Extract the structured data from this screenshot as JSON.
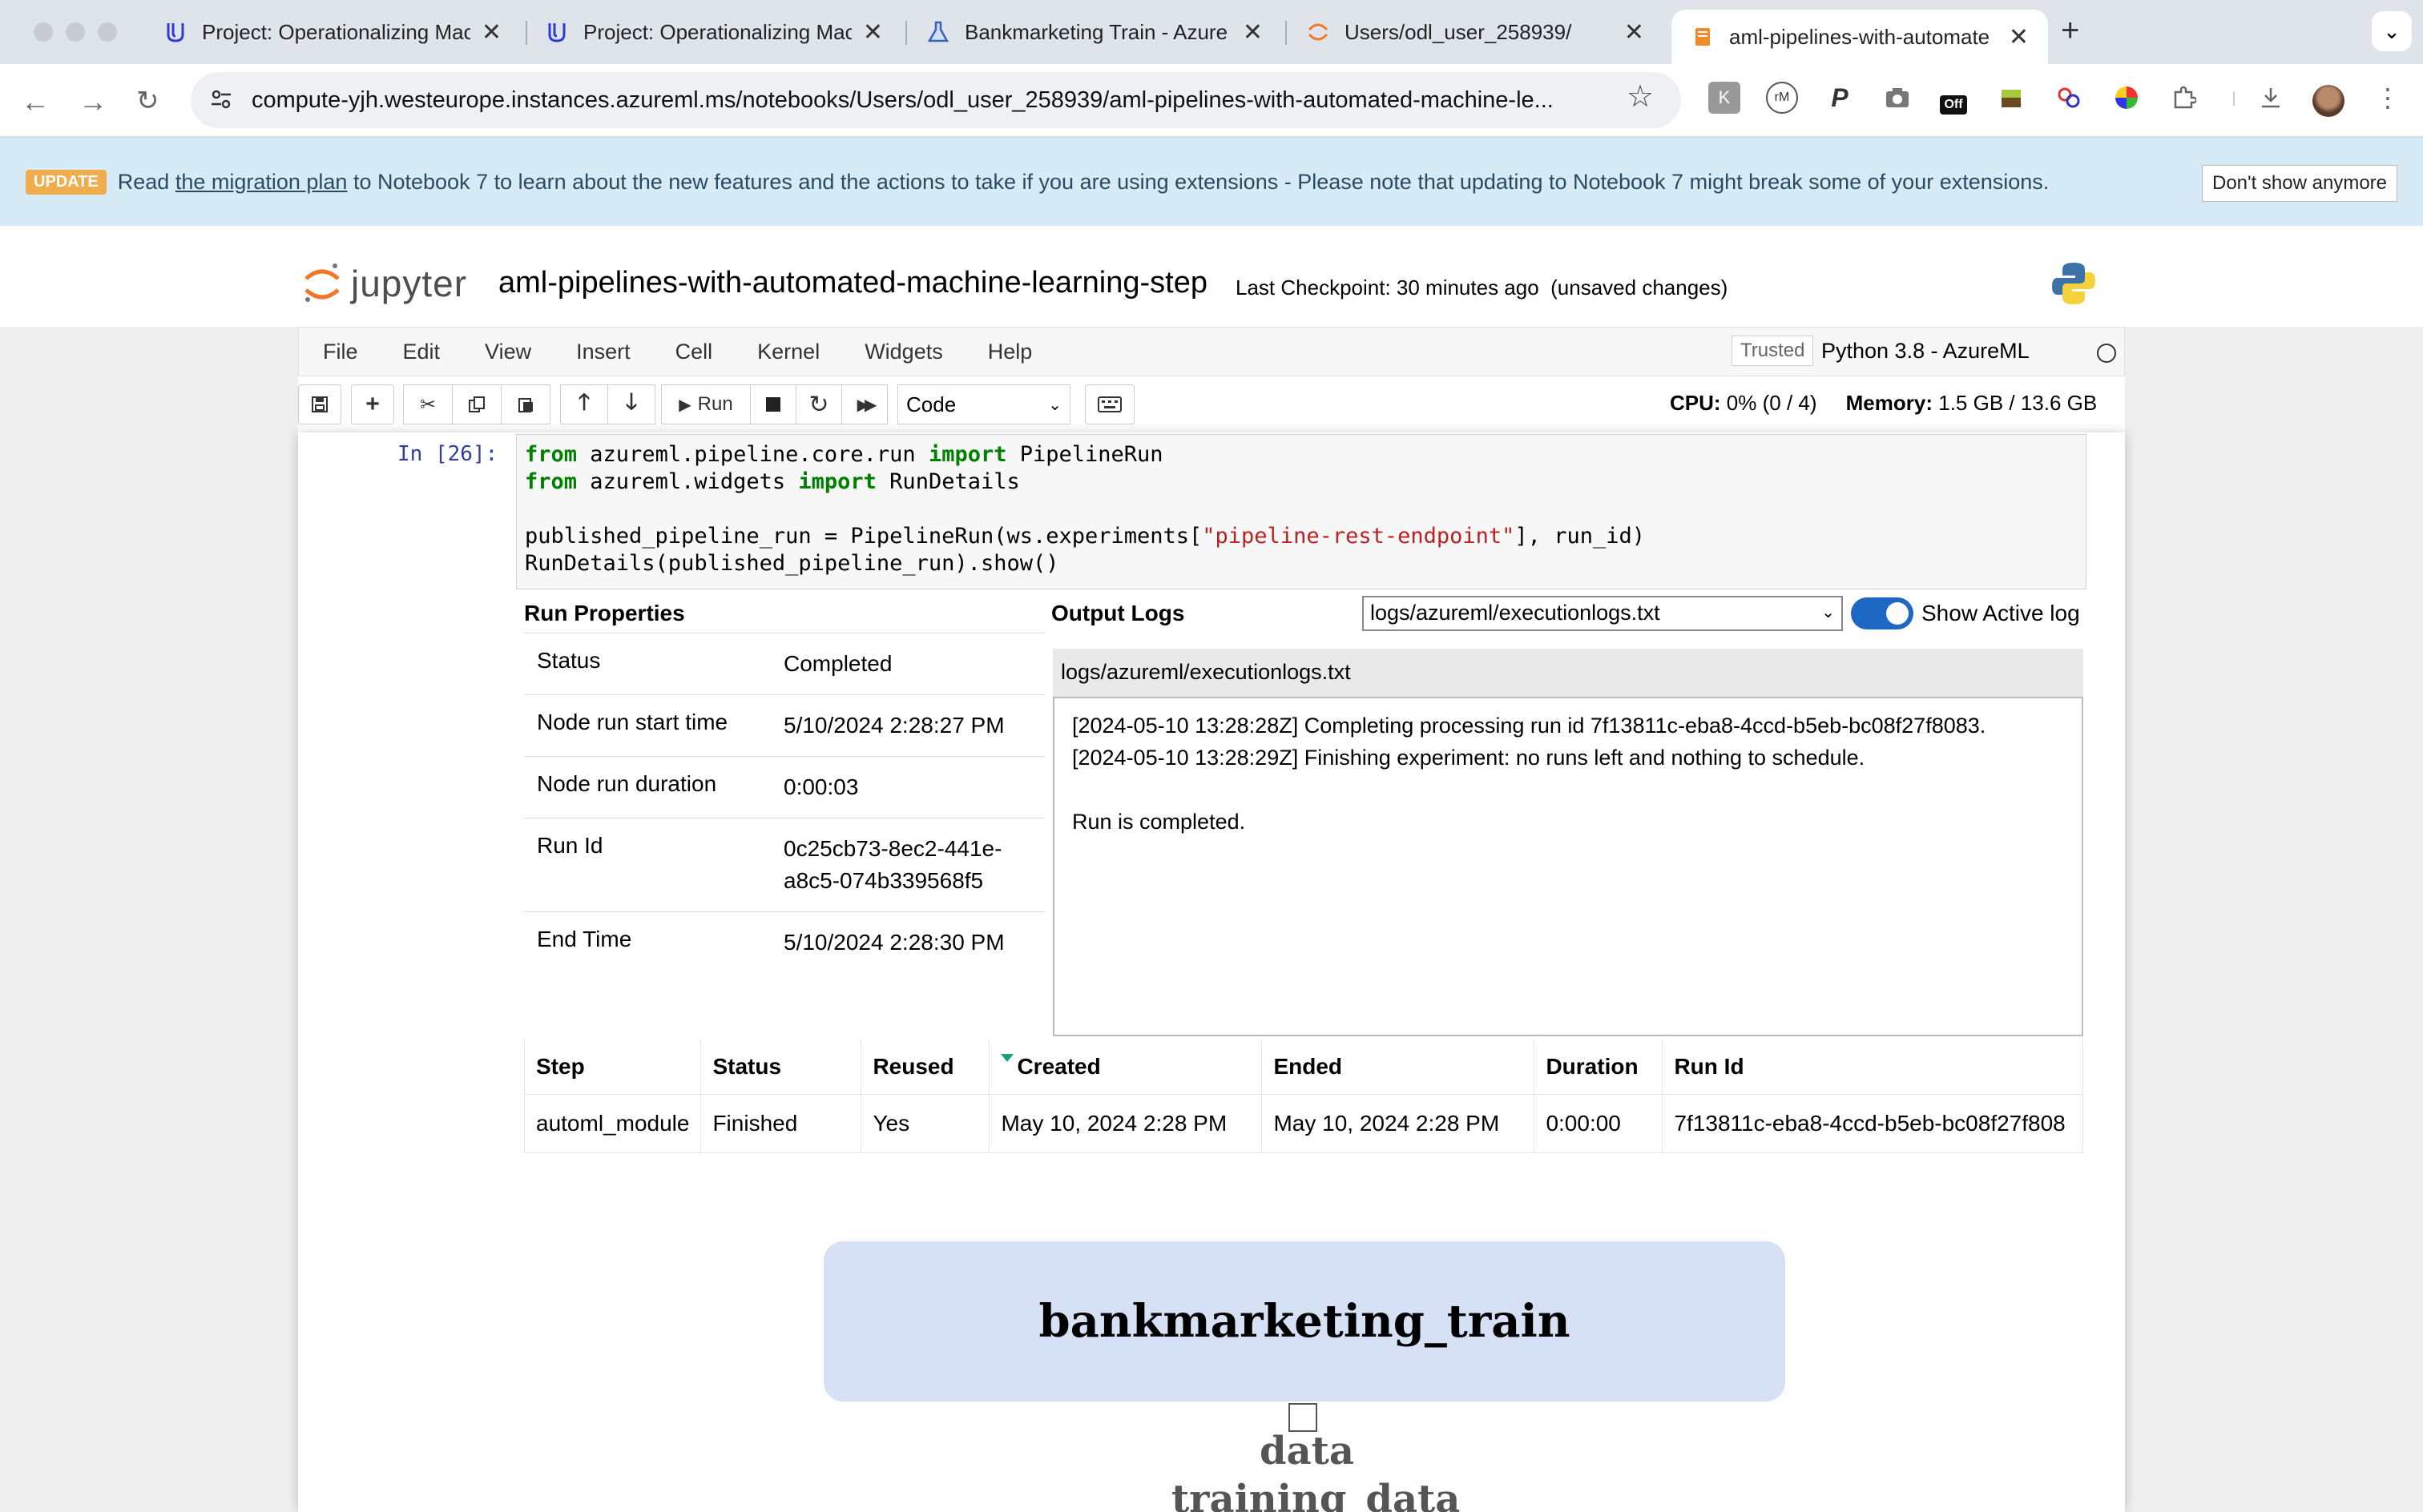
{
  "browser": {
    "tabs": [
      {
        "title": "Project: Operationalizing Mac",
        "icon": "udacity-icon"
      },
      {
        "title": "Project: Operationalizing Mac",
        "icon": "udacity-icon"
      },
      {
        "title": "Bankmarketing Train - Azure /",
        "icon": "azure-ml-flask-icon"
      },
      {
        "title": "Users/odl_user_258939/",
        "icon": "jupyter-icon"
      },
      {
        "title": "aml-pipelines-with-automate",
        "icon": "notebook-icon"
      }
    ],
    "url": "compute-yjh.westeurope.instances.azureml.ms/notebooks/Users/odl_user_258939/aml-pipelines-with-automated-machine-le...",
    "extension_badge": "Off"
  },
  "update_bar": {
    "badge": "UPDATE",
    "text_before": "Read",
    "link": "the migration plan",
    "text_after": "to Notebook 7 to learn about the new features and the actions to take if you are using extensions - Please note that updating to Notebook 7 might break some of your extensions.",
    "dismiss": "Don't show anymore"
  },
  "header": {
    "logo_text": "jupyter",
    "notebook_name": "aml-pipelines-with-automated-machine-learning-step",
    "checkpoint": "Last Checkpoint: 30 minutes ago",
    "unsaved": "(unsaved changes)"
  },
  "menu": {
    "items": [
      "File",
      "Edit",
      "View",
      "Insert",
      "Cell",
      "Kernel",
      "Widgets",
      "Help"
    ],
    "trusted": "Trusted",
    "kernel": "Python 3.8 - AzureML"
  },
  "toolbar": {
    "run": "Run",
    "cell_type": "Code",
    "cpu_label": "CPU:",
    "cpu_value": "0% (0 / 4)",
    "mem_label": "Memory:",
    "mem_value": "1.5 GB / 13.6 GB"
  },
  "cell": {
    "prompt": "In [26]:"
  },
  "run_properties": {
    "title": "Run Properties",
    "rows": [
      {
        "key": "Status",
        "value": "Completed"
      },
      {
        "key": "Node run start time",
        "value": "5/10/2024 2:28:27 PM"
      },
      {
        "key": "Node run duration",
        "value": "0:00:03"
      },
      {
        "key": "Run Id",
        "value": "0c25cb73-8ec2-441e-a8c5-074b339568f5"
      },
      {
        "key": "End Time",
        "value": "5/10/2024 2:28:30 PM"
      }
    ]
  },
  "output_logs": {
    "title": "Output Logs",
    "selected_log": "logs/azureml/executionlogs.txt",
    "toggle_label": "Show Active log",
    "log_header": "logs/azureml/executionlogs.txt",
    "lines": [
      "[2024-05-10 13:28:28Z] Completing processing run id 7f13811c-eba8-4ccd-b5eb-bc08f27f8083.",
      "[2024-05-10 13:28:29Z] Finishing experiment: no runs left and nothing to schedule.",
      "",
      "Run is completed."
    ]
  },
  "steps_table": {
    "headers": [
      "Step",
      "Status",
      "Reused",
      "Created",
      "Ended",
      "Duration",
      "Run Id"
    ],
    "rows": [
      [
        "automl_module",
        "Finished",
        "Yes",
        "May 10, 2024 2:28 PM",
        "May 10, 2024 2:28 PM",
        "0:00:00",
        "7f13811c-eba8-4ccd-b5eb-bc08f27f808"
      ]
    ]
  },
  "graph": {
    "node": "bankmarketing_train",
    "label1": "data",
    "label2": "training_data"
  }
}
